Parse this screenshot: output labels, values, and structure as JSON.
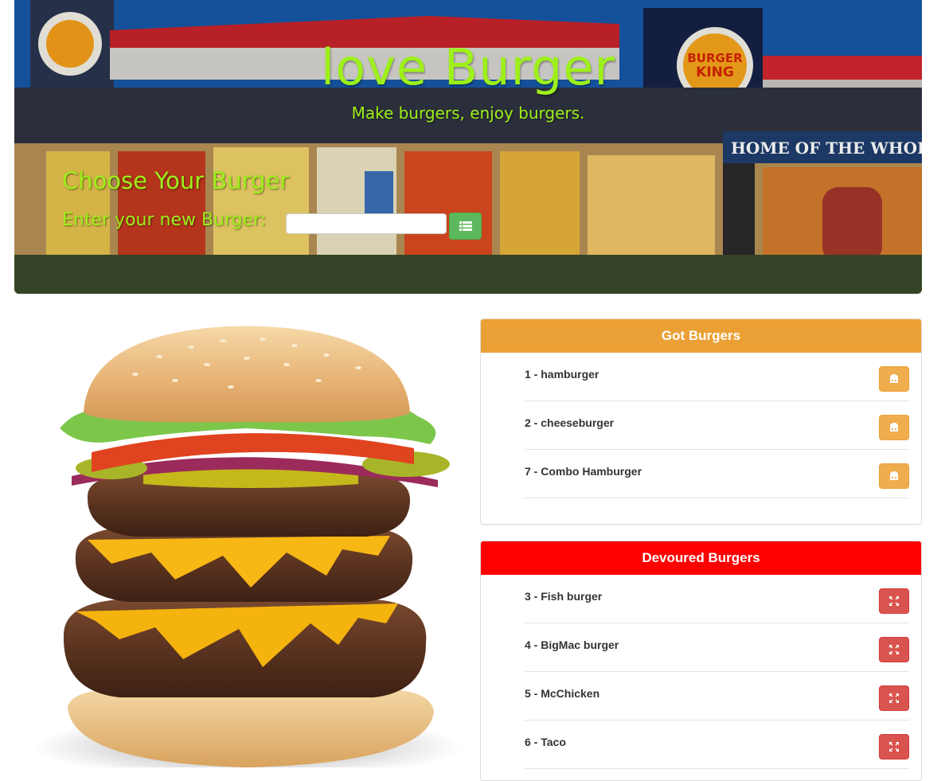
{
  "hero": {
    "title": "love Burger",
    "subtitle": "Make burgers, enjoy burgers.",
    "form_title": "Choose Your Burger",
    "input_label": "Enter your new Burger:",
    "input_value": "",
    "input_placeholder": "",
    "add_icon": "list-icon",
    "sign_text": "HOME OF THE WHOPPER",
    "logo_text_top": "BURGER",
    "logo_text_bottom": "KING"
  },
  "got_panel": {
    "title": "Got Burgers",
    "action_icon": "eat-icon",
    "items": [
      {
        "label": "1 - hamburger"
      },
      {
        "label": "2 - cheeseburger"
      },
      {
        "label": "7 - Combo Hamburger"
      }
    ]
  },
  "devoured_panel": {
    "title": "Devoured Burgers",
    "action_icon": "remove-icon",
    "items": [
      {
        "label": "3 - Fish burger"
      },
      {
        "label": "4 - BigMac burger"
      },
      {
        "label": "5 - McChicken"
      },
      {
        "label": "6 - Taco"
      }
    ]
  },
  "colors": {
    "accent_text": "#9ef01a",
    "got_header": "#eba035",
    "devoured_header": "#ff0000",
    "add_button": "#5cb85c",
    "warning_button": "#f0ad4e",
    "danger_button": "#d9534f"
  }
}
